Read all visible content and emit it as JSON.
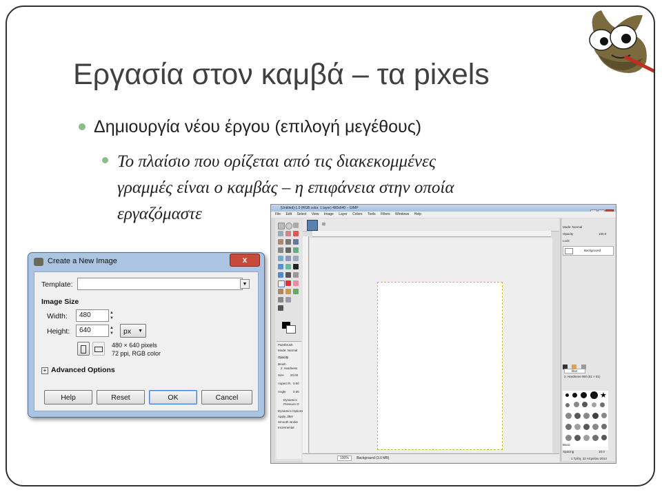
{
  "slide": {
    "title": "Εργασία στον καμβά – τα pixels",
    "bullet1": "Δημιουργία νέου έργου (επιλογή μεγέθους)",
    "bullet2_lines": [
      "Το πλαίσιο που ορίζεται από τις διακεκομμένες",
      "γραμμές είναι ο καμβάς – η επιφάνεια στην οποία",
      "εργαζόμαστε"
    ],
    "accent_color": "#90b98c"
  },
  "dialog": {
    "title": "Create a New Image",
    "close_label": "x",
    "template_label": "Template:",
    "template_value": "",
    "image_size_label": "Image Size",
    "width_label": "Width:",
    "width_value": "480",
    "height_label": "Height:",
    "height_value": "640",
    "unit_value": "px",
    "info_line1": "480 × 640 pixels",
    "info_line2": "72 ppi, RGB color",
    "advanced_label": "Advanced Options",
    "buttons": {
      "help": "Help",
      "reset": "Reset",
      "ok": "OK",
      "cancel": "Cancel"
    }
  },
  "gimp": {
    "window_title": "[Untitled]-1.0 (RGB color, 1 layer) 480x640 – GIMP",
    "menu": [
      "File",
      "Edit",
      "Select",
      "View",
      "Image",
      "Layer",
      "Colors",
      "Tools",
      "Filters",
      "Windows",
      "Help"
    ],
    "status_zoom": "100%",
    "status_text": "Background (3.0 MB)",
    "dock": {
      "mode_label": "Mode: Normal",
      "opacity_label": "Opacity",
      "opacity_value": "100.0",
      "lock_label": "Lock:",
      "layer_name": "Background",
      "brush_name": "2. Hardness 050 (51 × 51)",
      "filter_placeholder": "filter",
      "basic_label": "Basic",
      "spacing_label": "Spacing",
      "spacing_value": "10.0"
    },
    "tool_options": {
      "title": "Paintbrush",
      "mode": "Mode: Normal",
      "opacity": "Opacity",
      "brush": "Brush",
      "brush_value": "2. Hardness",
      "size": "Size",
      "size_value": "20.00",
      "aspect": "Aspect R.",
      "aspect_value": "0.00",
      "angle": "Angle",
      "angle_value": "0.00",
      "dynamics": "Dynamics",
      "dynamics_value": "Pressure O",
      "dyn_options": "Dynamics Options",
      "apply_jitter": "Apply Jitter",
      "smooth": "Smooth stroke",
      "incremental": "Incremental"
    },
    "datetime": "1 Τρίτη, 22 Απριλίου 2014"
  }
}
